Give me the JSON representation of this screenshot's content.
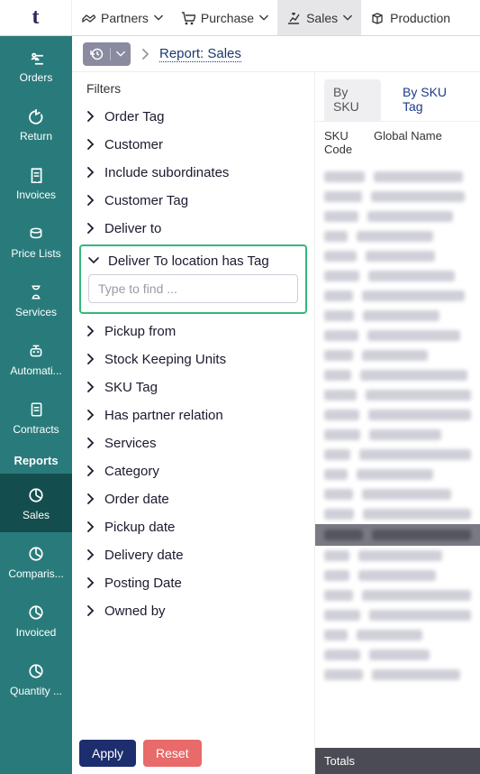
{
  "logo": "t",
  "topmenu": [
    {
      "label": "Partners",
      "icon": "handshake",
      "active": false
    },
    {
      "label": "Purchase",
      "icon": "cart",
      "active": false
    },
    {
      "label": "Sales",
      "icon": "sales",
      "active": true
    },
    {
      "label": "Production",
      "icon": "box",
      "active": false,
      "noChevron": true
    }
  ],
  "sidenav": [
    {
      "label": "Orders",
      "icon": "orders"
    },
    {
      "label": "Return",
      "icon": "return"
    },
    {
      "label": "Invoices",
      "icon": "invoice"
    },
    {
      "label": "Price Lists",
      "icon": "coins"
    },
    {
      "label": "Services",
      "icon": "hourglass"
    },
    {
      "label": "Automati...",
      "icon": "robot"
    },
    {
      "label": "Contracts",
      "icon": "contract"
    }
  ],
  "sidenav_section": "Reports",
  "sidenav_reports": [
    {
      "label": "Sales",
      "active": true
    },
    {
      "label": "Comparis...",
      "active": false
    },
    {
      "label": "Invoiced",
      "active": false
    },
    {
      "label": "Quantity ...",
      "active": false
    }
  ],
  "breadcrumb": {
    "title": "Report: Sales"
  },
  "filters_title": "Filters",
  "filters": [
    "Order Tag",
    "Customer",
    "Include subordinates",
    "Customer Tag",
    "Deliver to"
  ],
  "filter_expanded": {
    "label": "Deliver To location has Tag",
    "placeholder": "Type to find ..."
  },
  "filters_after": [
    "Pickup from",
    "Stock Keeping Units",
    "SKU Tag",
    "Has partner relation",
    "Services",
    "Category",
    "Order date",
    "Pickup date",
    "Delivery date",
    "Posting Date",
    "Owned by"
  ],
  "actions": {
    "apply": "Apply",
    "reset": "Reset"
  },
  "tabs": [
    {
      "label": "By SKU",
      "active": true
    },
    {
      "label": "By SKU Tag",
      "active": false
    }
  ],
  "table": {
    "col1": "SKU Code",
    "col2": "Global Name"
  },
  "totals_label": "Totals"
}
